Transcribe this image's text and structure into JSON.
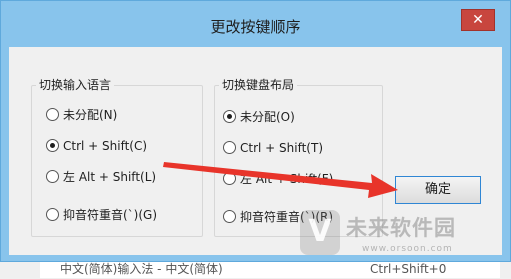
{
  "dialog": {
    "title": "更改按键顺序",
    "close_glyph": "✕",
    "ok_label": "确定"
  },
  "input_language_group": {
    "title": "切换输入语言",
    "options": [
      {
        "label": "未分配(N)",
        "checked": false
      },
      {
        "label": "Ctrl + Shift(C)",
        "checked": true
      },
      {
        "label": "左 Alt + Shift(L)",
        "checked": false
      },
      {
        "label": "抑音符重音(`)(G)",
        "checked": false
      }
    ]
  },
  "keyboard_layout_group": {
    "title": "切换键盘布局",
    "options": [
      {
        "label": "未分配(O)",
        "checked": true
      },
      {
        "label": "Ctrl + Shift(T)",
        "checked": false
      },
      {
        "label": "左 Alt + Shift(F)",
        "checked": false
      },
      {
        "label": "抑音符重音(`)(R)",
        "checked": false
      }
    ]
  },
  "background": {
    "right_edge_text": "经",
    "bottom_row_text": "中文(简体)输入法 - 中文(简体)",
    "bottom_row_right_text": "Ctrl+Shift+0"
  },
  "watermark": {
    "logo_glyph": "V",
    "name": "未来软件园",
    "url": "www.orsoon.com"
  },
  "colors": {
    "title_bar": "#88c4ec",
    "close_button": "#c8463e",
    "ok_border": "#2f86d4",
    "annotation_arrow": "#e8342a"
  }
}
